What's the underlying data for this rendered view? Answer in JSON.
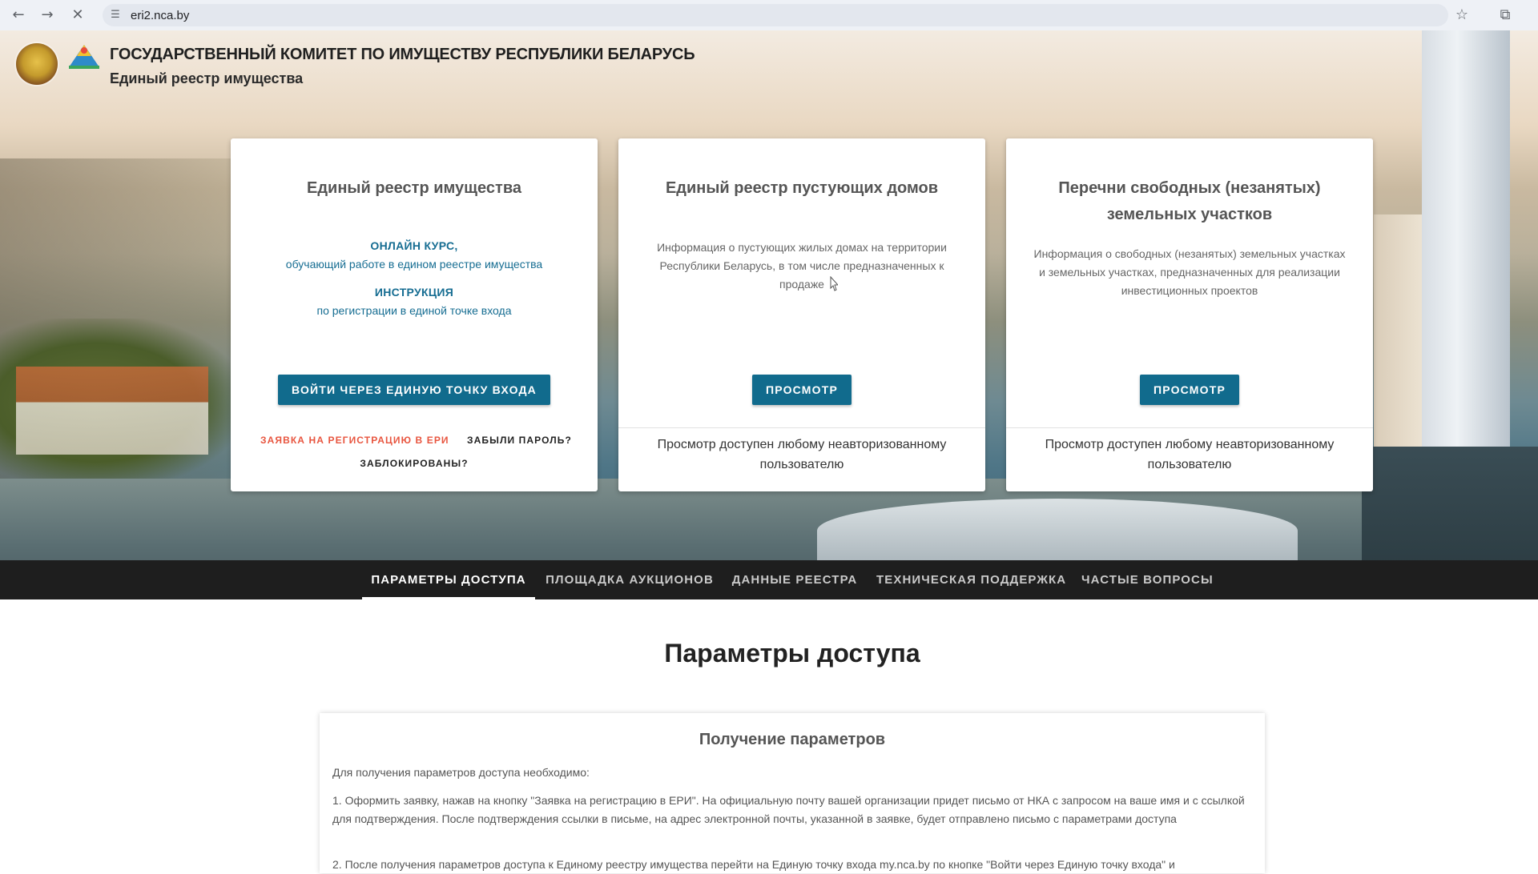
{
  "browser": {
    "url": "eri2.nca.by",
    "back_icon": "←",
    "forward_icon": "→",
    "stop_icon": "✕",
    "site_info_icon": "☰",
    "bookmark_icon": "☆",
    "extensions_icon": "⧉"
  },
  "header": {
    "title": "ГОСУДАРСТВЕННЫЙ КОМИТЕТ ПО ИМУЩЕСТВУ РЕСПУБЛИКИ БЕЛАРУСЬ",
    "subtitle": "Единый реестр имущества"
  },
  "cards": [
    {
      "title": "Единый реестр имущества",
      "course_heading": "ОНЛАЙН КУРС,",
      "course_sub": "обучающий работе в едином реестре имущества",
      "instruction_heading": "ИНСТРУКЦИЯ",
      "instruction_sub": "по регистрации в единой точке входа",
      "button": "ВОЙТИ ЧЕРЕЗ ЕДИНУЮ ТОЧКУ ВХОДА",
      "register_link": "ЗАЯВКА НА РЕГИСТРАЦИЮ В ЕРИ",
      "forgot_link": "ЗАБЫЛИ ПАРОЛЬ?",
      "blocked_link": "ЗАБЛОКИРОВАНЫ?"
    },
    {
      "title": "Единый реестр пустующих домов",
      "description": "Информация о пустующих жилых домах на территории Республики Беларусь, в том числе предназначенных к продаже",
      "button": "ПРОСМОТР",
      "note": "Просмотр доступен любому неавторизованному пользователю"
    },
    {
      "title": "Перечни свободных (незанятых) земельных участков",
      "description": "Информация о свободных (незанятых) земельных участках и земельных участках, предназначенных для реализации инвестиционных проектов",
      "button": "ПРОСМОТР",
      "note": "Просмотр доступен любому неавторизованному пользователю"
    }
  ],
  "tabs": [
    {
      "label": "ПАРАМЕТРЫ ДОСТУПА",
      "active": true
    },
    {
      "label": "ПЛОЩАДКА АУКЦИОНОВ",
      "active": false
    },
    {
      "label": "ДАННЫЕ РЕЕСТРА",
      "active": false
    },
    {
      "label": "ТЕХНИЧЕСКАЯ ПОДДЕРЖКА",
      "active": false
    },
    {
      "label": "ЧАСТЫЕ ВОПРОСЫ",
      "active": false
    }
  ],
  "section": {
    "title": "Параметры доступа",
    "panel_title": "Получение параметров",
    "intro": "Для получения параметров доступа необходимо:",
    "step1": "1. Оформить заявку, нажав на кнопку \"Заявка на регистрацию в ЕРИ\". На официальную почту вашей организации придет письмо от НКА с запросом на ваше имя и с ссылкой для подтверждения. После подтверждения ссылки в письме, на адрес электронной почты, указанной в заявке, будет отправлено письмо с параметрами доступа",
    "step2": "2. После получения параметров доступа к Единому реестру имущества перейти на Единую точку входа my.nca.by по кнопке \"Войти через Единую точку входа\" и"
  },
  "colors": {
    "primary": "#116b8d",
    "link": "#166d92",
    "register_link": "#e8553f",
    "tabbar": "#1e1e1e"
  }
}
